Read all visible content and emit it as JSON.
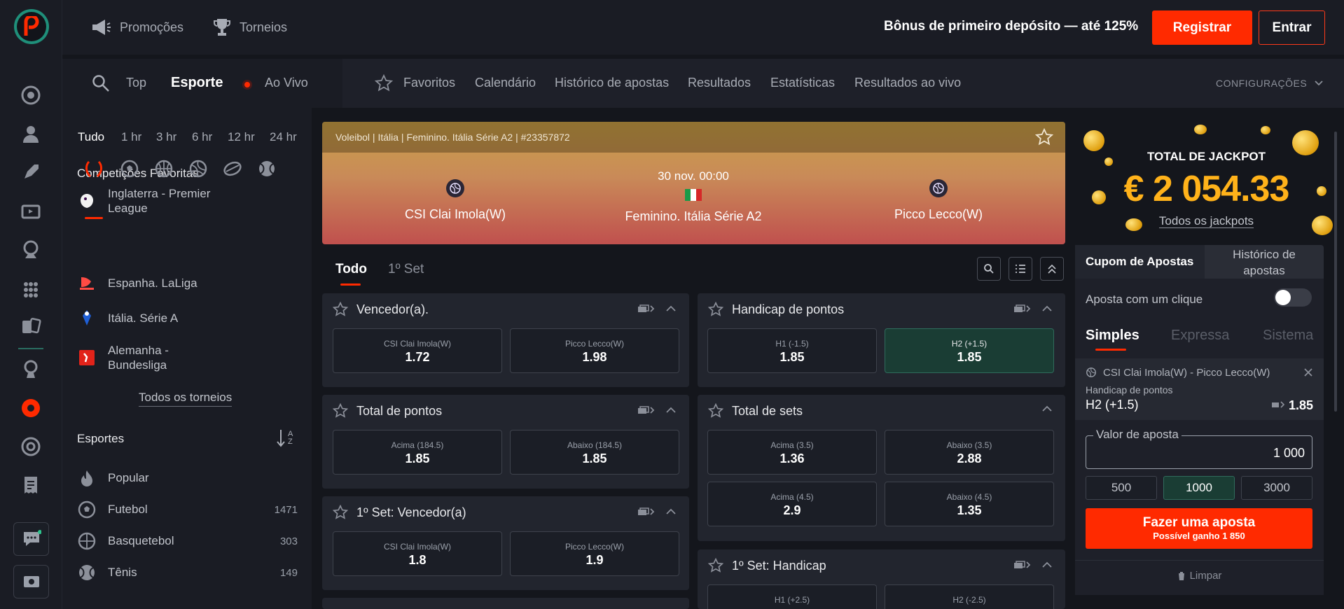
{
  "topbar": {
    "promo_label": "Promoções",
    "tournaments_label": "Torneios",
    "bonus_text": "Bônus de primeiro depósito — até 125%",
    "register_label": "Registrar",
    "login_label": "Entrar"
  },
  "subnav": {
    "top_label": "Top",
    "sport_label": "Esporte",
    "live_label": "Ao Vivo",
    "favorites_label": "Favoritos",
    "calendar_label": "Calendário",
    "history_label": "Histórico de apostas",
    "results_label": "Resultados",
    "stats_label": "Estatísticas",
    "live_results_label": "Resultados ao vivo",
    "settings_label": "CONFIGURAÇÕES"
  },
  "leftpanel": {
    "time_filters": [
      "Tudo",
      "1 hr",
      "3 hr",
      "6 hr",
      "12 hr",
      "24 hr"
    ],
    "fav_competitions_title": "Competições Favoritas",
    "leagues": [
      {
        "name": "Inglaterra - Premier League"
      },
      {
        "name": "Espanha. LaLiga"
      },
      {
        "name": "Itália. Série A"
      },
      {
        "name": "Alemanha - Bundesliga"
      }
    ],
    "all_tournaments_label": "Todos os torneios",
    "sports_title": "Esportes",
    "sort_icon_label": "A Z",
    "sports": [
      {
        "name": "Popular",
        "count": ""
      },
      {
        "name": "Futebol",
        "count": "1471"
      },
      {
        "name": "Basquetebol",
        "count": "303"
      },
      {
        "name": "Tênis",
        "count": "149"
      }
    ]
  },
  "match": {
    "breadcrumb": "Voleibol | Itália | Feminino. Itália Série A2 | #23357872",
    "home_team": "CSI Clai Imola(W)",
    "away_team": "Picco Lecco(W)",
    "datetime": "30 nov. 00:00",
    "competition": "Feminino. Itália Série A2"
  },
  "market_tabs": [
    "Todo",
    "1º Set"
  ],
  "markets": {
    "winner": {
      "title": "Vencedor(a).",
      "odds": [
        {
          "label": "CSI Clai Imola(W)",
          "value": "1.72"
        },
        {
          "label": "Picco Lecco(W)",
          "value": "1.98"
        }
      ]
    },
    "handicap": {
      "title": "Handicap de pontos",
      "odds": [
        {
          "label": "H1 (-1.5)",
          "value": "1.85"
        },
        {
          "label": "H2 (+1.5)",
          "value": "1.85"
        }
      ]
    },
    "total_points": {
      "title": "Total de pontos",
      "odds": [
        {
          "label": "Acima (184.5)",
          "value": "1.85"
        },
        {
          "label": "Abaixo (184.5)",
          "value": "1.85"
        }
      ]
    },
    "total_sets": {
      "title": "Total de sets",
      "odds": [
        {
          "label": "Acima (3.5)",
          "value": "1.36"
        },
        {
          "label": "Abaixo (3.5)",
          "value": "2.88"
        },
        {
          "label": "Acima (4.5)",
          "value": "2.9"
        },
        {
          "label": "Abaixo (4.5)",
          "value": "1.35"
        }
      ]
    },
    "set1_winner": {
      "title": "1º Set: Vencedor(a)",
      "odds": [
        {
          "label": "CSI Clai Imola(W)",
          "value": "1.8"
        },
        {
          "label": "Picco Lecco(W)",
          "value": "1.9"
        }
      ]
    },
    "set1_handicap": {
      "title": "1º Set: Handicap",
      "odds": [
        {
          "label": "H1 (+2.5)",
          "value": ""
        },
        {
          "label": "H2 (-2.5)",
          "value": ""
        }
      ]
    }
  },
  "jackpot": {
    "title": "TOTAL DE JACKPOT",
    "amount": "€ 2 054.33",
    "link_label": "Todos os jackpots"
  },
  "betslip": {
    "tab_coupon": "Cupom de Apostas",
    "tab_history": "Histórico de apostas",
    "one_click_label": "Aposta com um clique",
    "one_click_on": false,
    "types": [
      "Simples",
      "Expressa",
      "Sistema"
    ],
    "item": {
      "event": "CSI Clai Imola(W) - Picco Lecco(W)",
      "market": "Handicap de pontos",
      "selection": "H2 (+1.5)",
      "odd": "1.85"
    },
    "stake_label": "Valor de aposta",
    "stake_value": "1 000",
    "quick_amounts": [
      "500",
      "1000",
      "3000"
    ],
    "place_bet_label": "Fazer uma aposta",
    "possible_win": "Possível ganho 1 850",
    "clear_label": "Limpar"
  },
  "colors": {
    "accent": "#ff2a00",
    "selected": "#1a3d34",
    "jackpot": "#ffb21a",
    "brand_green": "#1f8f7a"
  }
}
